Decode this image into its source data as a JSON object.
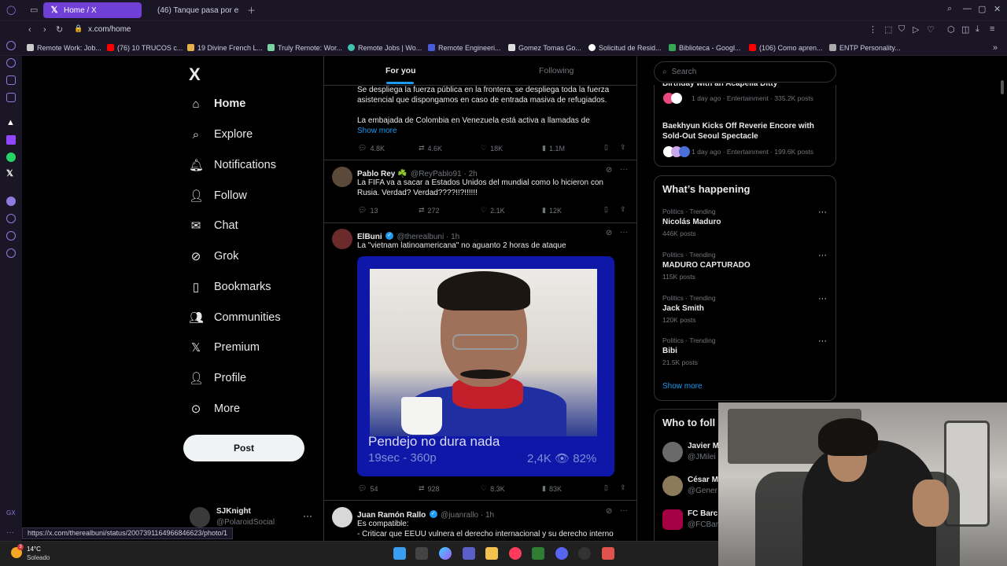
{
  "browser": {
    "tabs": [
      {
        "label": "Home / X"
      },
      {
        "label": "(46) Tanque pasa por enc"
      }
    ],
    "url": "x.com/home",
    "bookmarks": [
      {
        "label": "Remote Work: Job..."
      },
      {
        "label": "(76) 10 TRUCOS c..."
      },
      {
        "label": "19 Divine French L..."
      },
      {
        "label": "Truly Remote: Wor..."
      },
      {
        "label": "Remote Jobs | Wo..."
      },
      {
        "label": "Remote Engineeri..."
      },
      {
        "label": "Gomez Tomas Go..."
      },
      {
        "label": "Solicitud de Resid..."
      },
      {
        "label": "Biblioteca - Googl..."
      },
      {
        "label": "(106) Como apren..."
      },
      {
        "label": "ENTP Personality..."
      }
    ],
    "status_url": "https://x.com/therealbuni/status/2007391164966846623/photo/1"
  },
  "sidebar": {
    "logo": "X",
    "items": [
      {
        "label": "Home"
      },
      {
        "label": "Explore"
      },
      {
        "label": "Notifications"
      },
      {
        "label": "Follow"
      },
      {
        "label": "Chat"
      },
      {
        "label": "Grok"
      },
      {
        "label": "Bookmarks"
      },
      {
        "label": "Communities"
      },
      {
        "label": "Premium"
      },
      {
        "label": "Profile"
      },
      {
        "label": "More"
      }
    ],
    "post_label": "Post",
    "account": {
      "name": "SJKnight",
      "handle": "@PolaroidSocial",
      "more": "···"
    }
  },
  "feed": {
    "tabs": {
      "for_you": "For you",
      "following": "Following"
    },
    "tweets": [
      {
        "text_lines": [
          "Se despliega la fuerza pública en la frontera, se despliega toda la fuerza",
          "asistencial que dispongamos en caso de entrada masiva de refugiados.",
          "",
          "La embajada de Colombia en Venezuela está activa a llamadas de"
        ],
        "show_more": "Show more",
        "replies": "4.8K",
        "reposts": "4.6K",
        "likes": "18K",
        "views": "1.1M"
      },
      {
        "name": "Pablo Rey ☘️",
        "handle": "@ReyPablo91 · 2h",
        "text_lines": [
          "La FIFA va a sacar a Estados Unidos del mundial como lo hicieron con",
          "Rusia. Verdad? Verdad????!!?!!!!!!"
        ],
        "replies": "13",
        "reposts": "272",
        "likes": "2.1K",
        "views": "12K"
      },
      {
        "name": "ElBuni",
        "handle": "@therealbuni · 1h",
        "text_lines": [
          "La \"vietnam latinoamericana\" no aguanto 2 horas de ataque"
        ],
        "image": {
          "caption": "Pendejo no dura nada",
          "stats_left": "19sec - 360p",
          "stats_right": "2,4K 👁 82%"
        },
        "replies": "54",
        "reposts": "928",
        "likes": "8.3K",
        "views": "83K"
      },
      {
        "name": "Juan Ramón Rallo",
        "handle": "@juanrallo · 1h",
        "text_lines": [
          "Es compatible:",
          "- Criticar que EEUU vulnera el derecho internacional y su derecho interno"
        ]
      }
    ]
  },
  "right": {
    "search_placeholder": "Search",
    "trends_top": [
      {
        "title": "Birthday with an Acapella Ditty",
        "meta": "1 day ago · Entertainment · 335.2K posts"
      },
      {
        "title_lines": [
          "Baekhyun Kicks Off Reverie Encore with",
          "Sold-Out Seoul Spectacle"
        ],
        "meta": "1 day ago · Entertainment · 199.6K posts"
      }
    ],
    "whats_happening": {
      "title": "What’s happening",
      "items": [
        {
          "meta": "Politics · Trending",
          "title": "Nicolás Maduro",
          "count": "446K posts"
        },
        {
          "meta": "Politics · Trending",
          "title": "MADURO CAPTURADO",
          "count": "115K posts"
        },
        {
          "meta": "Politics · Trending",
          "title": "Jack Smith",
          "count": "120K posts"
        },
        {
          "meta": "Politics · Trending",
          "title": "Bibi",
          "count": "21.5K posts"
        }
      ],
      "show_more": "Show more"
    },
    "who_to_follow": {
      "title": "Who to foll",
      "items": [
        {
          "name": "Javier M",
          "handle": "@JMilei"
        },
        {
          "name": "César M",
          "handle": "@Gener"
        },
        {
          "name": "FC Barc",
          "handle": "@FCBarc"
        }
      ]
    }
  },
  "taskbar": {
    "badge": "3",
    "temp": "14°C",
    "weather": "Soleado"
  }
}
